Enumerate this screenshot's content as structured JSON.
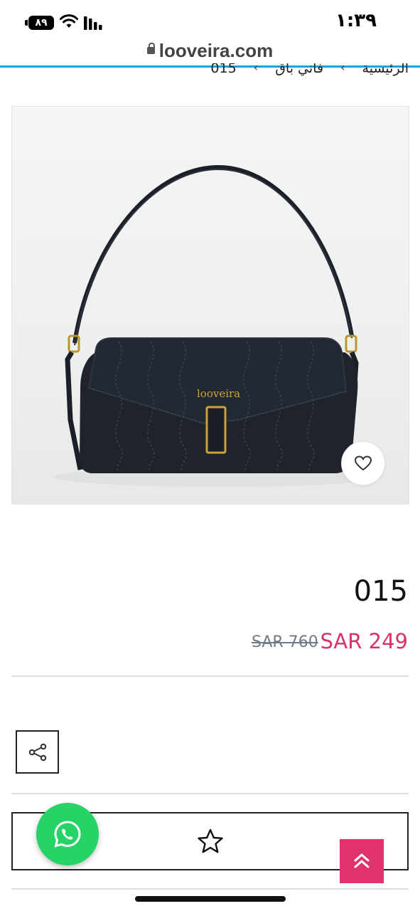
{
  "status_bar": {
    "time": "١:٣٩",
    "battery": "٨٩"
  },
  "browser": {
    "url": "looveira.com"
  },
  "breadcrumb": {
    "items": [
      "الرئيسية",
      "فاني باق",
      "015"
    ]
  },
  "product": {
    "brand_on_bag": "looveira",
    "title": "015",
    "price_old": "SAR 760",
    "price_new": "SAR 249"
  },
  "colors": {
    "accent": "#e0326b",
    "price": "#d6336c",
    "whatsapp": "#25d366",
    "progress": "#1aa3e0"
  },
  "icons": [
    "wifi-icon",
    "signal-icon",
    "lock-icon",
    "heart-icon",
    "share-icon",
    "star-icon",
    "whatsapp-icon",
    "double-chevron-up-icon"
  ]
}
